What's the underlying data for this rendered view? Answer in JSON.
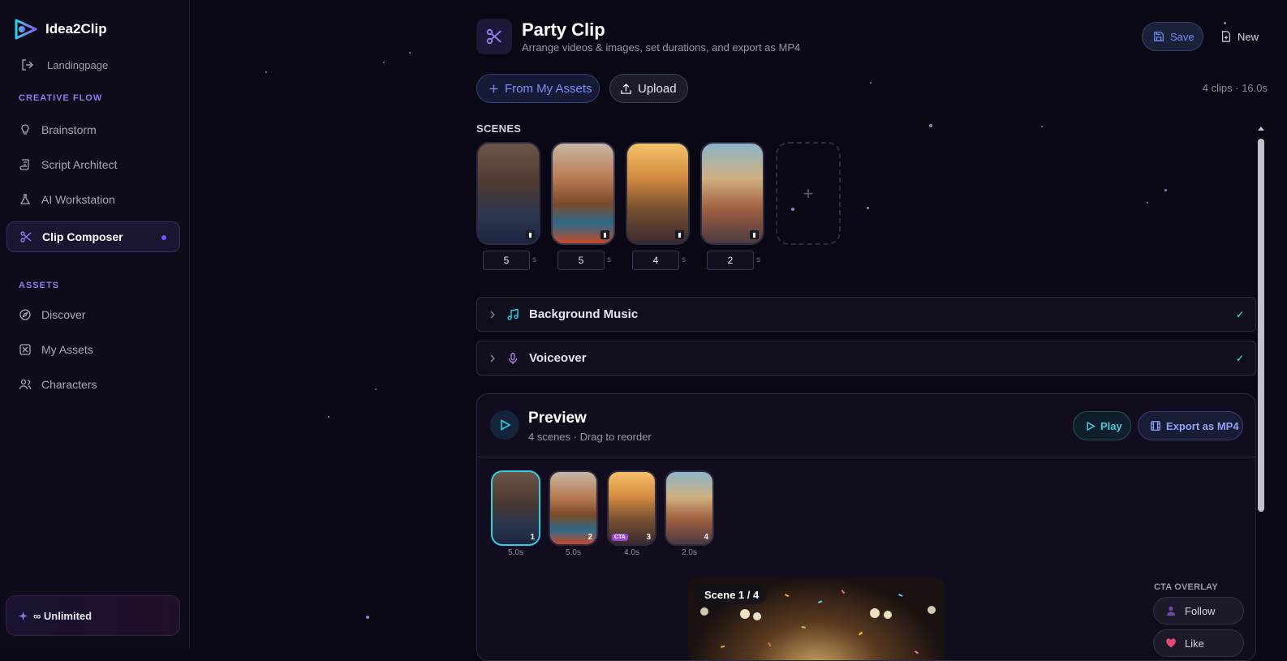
{
  "app": {
    "name": "Idea2Clip"
  },
  "sidebar": {
    "landing": "Landingpage",
    "creative_flow_label": "CREATIVE FLOW",
    "creative_items": [
      {
        "label": "Brainstorm",
        "icon": "lightbulb-icon"
      },
      {
        "label": "Script Architect",
        "icon": "scroll-icon"
      },
      {
        "label": "AI Workstation",
        "icon": "flask-icon"
      },
      {
        "label": "Clip Composer",
        "icon": "scissors-icon",
        "active": true
      }
    ],
    "assets_label": "ASSETS",
    "asset_items": [
      {
        "label": "Discover",
        "icon": "compass-icon"
      },
      {
        "label": "My Assets",
        "icon": "assets-icon"
      },
      {
        "label": "Characters",
        "icon": "users-icon"
      }
    ],
    "plan": "∞ Unlimited"
  },
  "header": {
    "title": "Party Clip",
    "subtitle": "Arrange videos & images, set durations, and export as MP4",
    "save": "Save",
    "new": "New"
  },
  "toolbar": {
    "from_assets": "From My Assets",
    "upload": "Upload",
    "summary": "4 clips · 16.0s"
  },
  "scenes": {
    "label": "SCENES",
    "items": [
      {
        "duration": "5",
        "unit": "s"
      },
      {
        "duration": "5",
        "unit": "s"
      },
      {
        "duration": "4",
        "unit": "s"
      },
      {
        "duration": "2",
        "unit": "s"
      }
    ],
    "add": "+"
  },
  "panels": {
    "music": {
      "label": "Background Music",
      "check": "✓"
    },
    "voiceover": {
      "label": "Voiceover",
      "check": "✓"
    }
  },
  "preview": {
    "title": "Preview",
    "subtitle": "4 scenes · Drag to reorder",
    "play": "Play",
    "export": "Export as MP4",
    "thumbs": [
      {
        "num": "1",
        "dur": "5.0s"
      },
      {
        "num": "2",
        "dur": "5.0s"
      },
      {
        "num": "3",
        "dur": "4.0s",
        "tag": "CTA"
      },
      {
        "num": "4",
        "dur": "2.0s"
      }
    ],
    "stage_label": "Scene 1 / 4",
    "cta_overlay": {
      "label": "CTA OVERLAY",
      "follow": "Follow",
      "like": "Like"
    }
  },
  "colors": {
    "accent": "#6b5cf5",
    "cyan": "#2fd0e2",
    "background": "#0b0816"
  }
}
